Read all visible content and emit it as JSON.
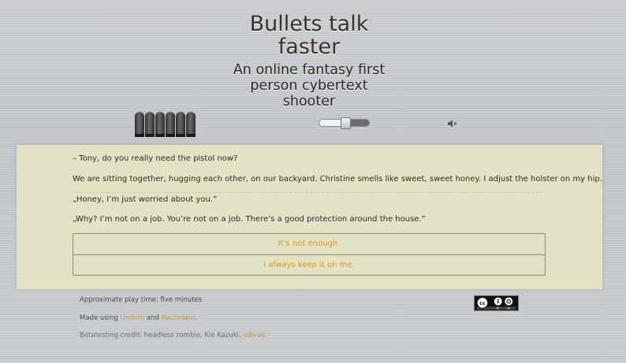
{
  "header": {
    "title": "Bullets talk faster",
    "subtitle": "An online fantasy first person cybertext shooter"
  },
  "hud": {
    "ammo_count": 6,
    "volume": 0.52,
    "icons": {
      "ammo": "bullet-icon",
      "sound": "speaker-mute-icon"
    }
  },
  "story": {
    "paragraphs": [
      "– Tony, do you really need the pistol now?",
      "We are sitting together, hugging each other, on our backyard. Christine smells like sweet, sweet honey. I adjust the holster on my hip.",
      "„Honey, I’m just worried about you.”",
      "„Why? I’m not on a job. You’re not on a job. There’s a good protection around the house.”"
    ],
    "choices": [
      "It’s not enough.",
      "I always keep it on me."
    ]
  },
  "footer": {
    "playtime": "Approximate play time: five minutes",
    "made_prefix": "Made using",
    "undum": "Undum",
    "and": "and",
    "raconteur": "Raconteur",
    "made_suffix": ".",
    "beta_prefix": "Betatesting credit: headless zombie, Kie Kazuki,",
    "beta_link": "udivas",
    "license": "cc-by-sa-badge"
  },
  "colors": {
    "accent": "#d39a21",
    "panel": "#e3e2c4",
    "text": "#2b2b2b"
  }
}
